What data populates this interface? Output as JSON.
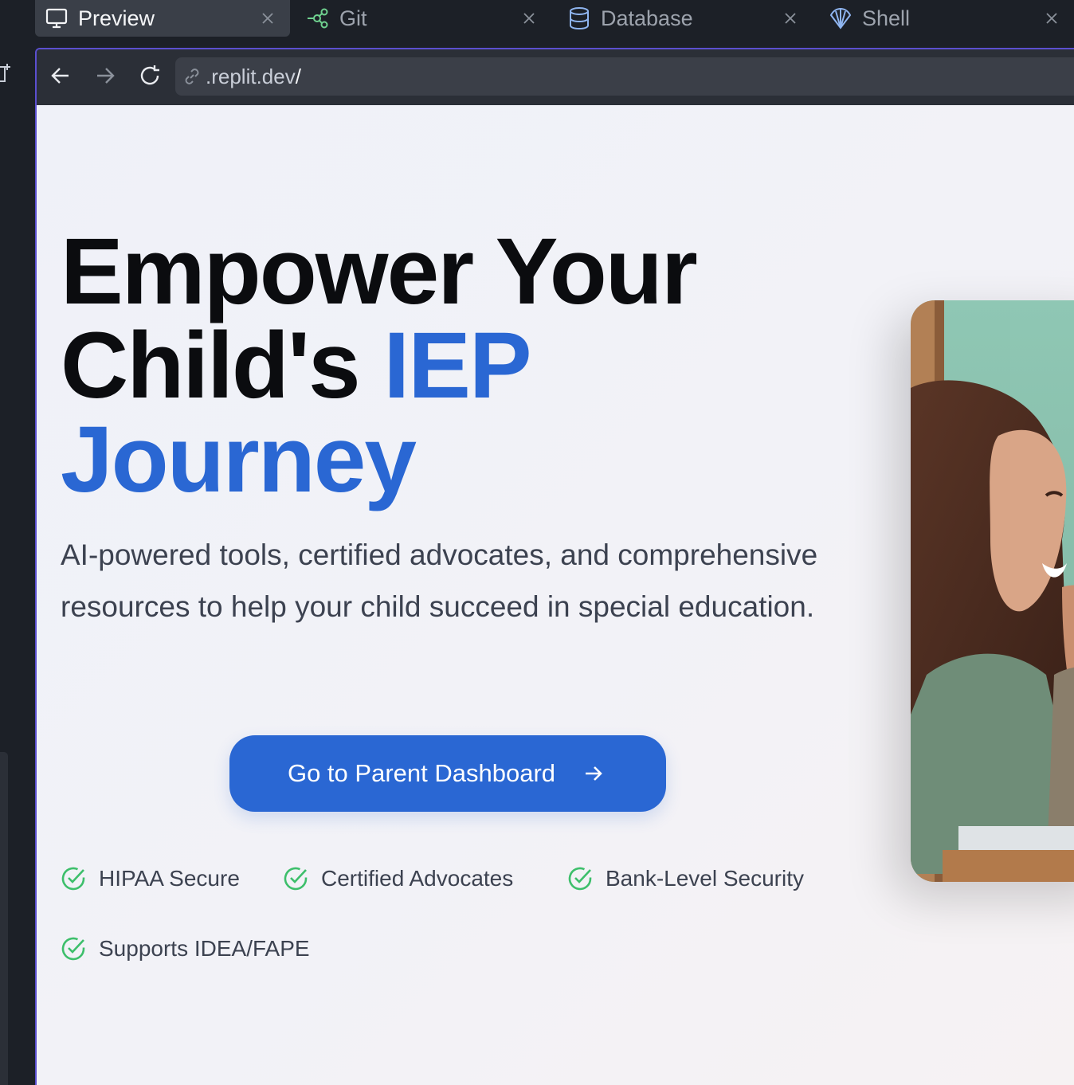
{
  "tabs": [
    {
      "label": "Preview",
      "icon": "monitor-icon",
      "active": true
    },
    {
      "label": "Git",
      "icon": "git-branch-icon",
      "active": false
    },
    {
      "label": "Database",
      "icon": "database-icon",
      "active": false
    },
    {
      "label": "Shell",
      "icon": "shell-icon",
      "active": false
    }
  ],
  "browser": {
    "url": ".replit.dev",
    "url_suffix": "/"
  },
  "hero": {
    "title_line1": "Empower Your",
    "title_line2_plain": "Child's ",
    "title_line2_accent": "IEP",
    "title_line3_accent": "Journey",
    "subtitle": "AI-powered tools, certified advocates, and comprehensive resources to help your child succeed in special education.",
    "cta_label": "Go to Parent Dashboard"
  },
  "features": [
    "HIPAA Secure",
    "Certified Advocates",
    "Bank-Level Security",
    "Supports IDEA/FAPE"
  ],
  "colors": {
    "accent": "#2a67d3",
    "check": "#3dbf6b",
    "ide_bg": "#1c2027",
    "focus_border": "#5b4fd0"
  }
}
